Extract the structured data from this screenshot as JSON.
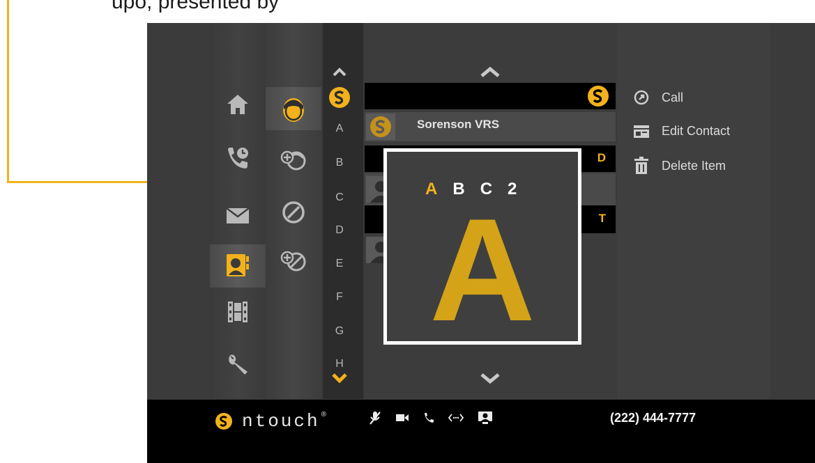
{
  "header_caption": "upo, presented by",
  "alphabet": [
    "A",
    "B",
    "C",
    "D",
    "E",
    "F",
    "G",
    "H"
  ],
  "contacts": {
    "header_letters": [
      "D",
      "T"
    ],
    "first_contact": "Sorenson VRS"
  },
  "actions": [
    {
      "label": "Call",
      "icon": "call-icon"
    },
    {
      "label": "Edit Contact",
      "icon": "edit-contact-icon"
    },
    {
      "label": "Delete Item",
      "icon": "trash-icon"
    }
  ],
  "popup": {
    "tabs": [
      "A",
      "B",
      "C",
      "2"
    ],
    "big_letter": "A"
  },
  "footer": {
    "brand": "ntouch",
    "brand_mark": "®",
    "phone": "(222) 444-7777"
  },
  "colors": {
    "accent": "#f2b21c",
    "background": "#3b3b3b",
    "bar": "#000000"
  }
}
